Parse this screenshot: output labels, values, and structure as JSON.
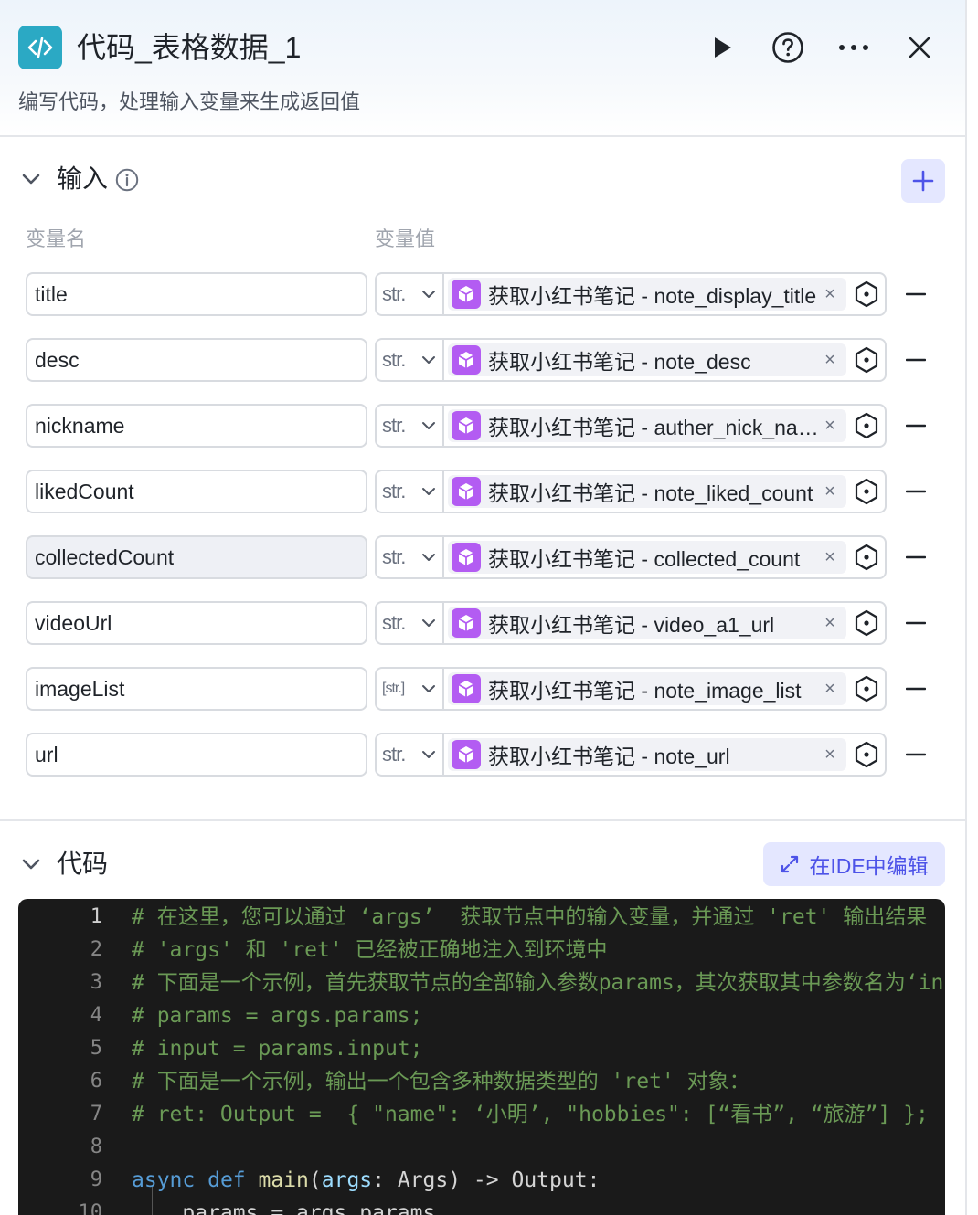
{
  "header": {
    "title": "代码_表格数据_1",
    "description": "编写代码，处理输入变量来生成返回值",
    "icon": "code-icon",
    "accent": "#2ba9c4"
  },
  "input_section": {
    "title": "输入",
    "col_name": "变量名",
    "col_value": "变量值",
    "rows": [
      {
        "name": "title",
        "type": "str.",
        "ref": "获取小红书笔记 - note_display_title"
      },
      {
        "name": "desc",
        "type": "str.",
        "ref": "获取小红书笔记 - note_desc"
      },
      {
        "name": "nickname",
        "type": "str.",
        "ref": "获取小红书笔记 - auther_nick_name"
      },
      {
        "name": "likedCount",
        "type": "str.",
        "ref": "获取小红书笔记 - note_liked_count"
      },
      {
        "name": "collectedCount",
        "type": "str.",
        "ref": "获取小红书笔记 - collected_count"
      },
      {
        "name": "videoUrl",
        "type": "str.",
        "ref": "获取小红书笔记 - video_a1_url"
      },
      {
        "name": "imageList",
        "type": "[str.]",
        "ref": "获取小红书笔记 - note_image_list"
      },
      {
        "name": "url",
        "type": "str.",
        "ref": "获取小红书笔记 - note_url"
      }
    ]
  },
  "code_section": {
    "title": "代码",
    "ide_button": "在IDE中编辑",
    "lines": [
      {
        "n": "1",
        "text": "# 在这里，您可以通过 ‘args’  获取节点中的输入变量，并通过 'ret' 输出结果"
      },
      {
        "n": "2",
        "text": "# 'args' 和 'ret' 已经被正确地注入到环境中"
      },
      {
        "n": "3",
        "text": "# 下面是一个示例，首先获取节点的全部输入参数params，其次获取其中参数名为‘input’的值："
      },
      {
        "n": "4",
        "text": "# params = args.params;"
      },
      {
        "n": "5",
        "text": "# input = params.input;"
      },
      {
        "n": "6",
        "text": "# 下面是一个示例，输出一个包含多种数据类型的 'ret' 对象："
      },
      {
        "n": "7",
        "text": "# ret: Output =  { \"name\": ‘小明’, \"hobbies\": [“看书”, “旅游”] };"
      },
      {
        "n": "8",
        "text": ""
      },
      {
        "n": "9",
        "kw1": "async",
        "kw2": "def",
        "fn": "main",
        "p1": "args",
        "rest1": ": Args) -> Output:"
      },
      {
        "n": "10",
        "text": "    params = args.params"
      }
    ]
  },
  "colors": {
    "primary": "#4d53e8",
    "primary_bg": "#e4e7ff",
    "ref_icon": "#b35cf2",
    "editor_bg": "#1a1a1a",
    "comment": "#6a9955"
  }
}
